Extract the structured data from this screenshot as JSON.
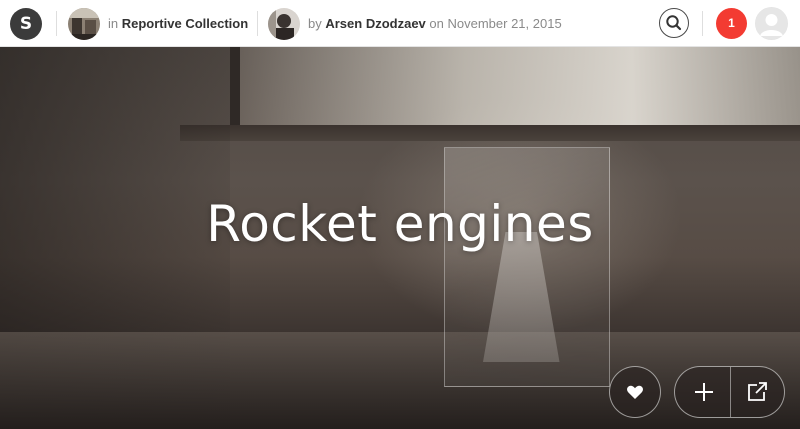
{
  "header": {
    "logo_letter": "S",
    "collection": {
      "prefix": "in",
      "name": "Reportive Collection"
    },
    "author": {
      "prefix": "by",
      "name": "Arsen Dzodzaev",
      "date_prefix": "on",
      "date": "November 21, 2015"
    },
    "notifications_count": "1"
  },
  "hero": {
    "title": "Rocket engines"
  },
  "icons": {
    "search": "search-icon",
    "like": "heart-icon",
    "add": "plus-icon",
    "share": "external-link-icon",
    "user": "user-avatar-icon"
  },
  "colors": {
    "notification": "#f33b32",
    "logo_bg": "#3b3b3b",
    "text_dark": "#333333",
    "text_muted": "#8a8a8a"
  }
}
